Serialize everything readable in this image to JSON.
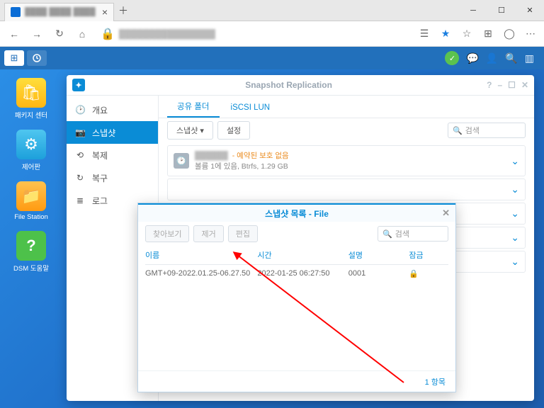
{
  "browser": {
    "tab_close": "×",
    "new_tab": "＋",
    "win_min": "─",
    "win_max": "☐",
    "win_close": "✕",
    "nav_back": "←",
    "nav_fwd": "→",
    "nav_reload": "↻",
    "nav_home": "⌂",
    "lock": "🔒",
    "reader": "☰",
    "star": "★",
    "fav": "☆",
    "ext": "⊞",
    "prof": "◯",
    "more": "⋯"
  },
  "dsm": {
    "launcher": "⊞",
    "chat": "💬",
    "user": "👤",
    "search": "🔍",
    "widget": "▥"
  },
  "desktop_icons": [
    {
      "label": "패키지 센터",
      "glyph": "🛍"
    },
    {
      "label": "제어판",
      "glyph": "⚙"
    },
    {
      "label": "File Station",
      "glyph": "📁"
    },
    {
      "label": "DSM 도움말",
      "glyph": "?"
    }
  ],
  "app": {
    "title": "Snapshot Replication",
    "win_help": "?",
    "win_min": "–",
    "win_max": "☐",
    "win_close": "✕",
    "sidebar": [
      {
        "icon": "🕑",
        "label": "개요"
      },
      {
        "icon": "📷",
        "label": "스냅샷"
      },
      {
        "icon": "⟲",
        "label": "복제"
      },
      {
        "icon": "↻",
        "label": "복구"
      },
      {
        "icon": "≣",
        "label": "로그"
      }
    ],
    "tabs": [
      {
        "label": "공유 폴더"
      },
      {
        "label": "iSCSI LUN"
      }
    ],
    "toolbar": {
      "snapshot": "스냅샷 ▾",
      "settings": "설정",
      "search_ph": "검색"
    },
    "folder": {
      "warn": "- 예약된 보호 없음",
      "sub": "볼륨 1에 있음, Btrfs, 1.29 GB",
      "time_glyph": "🕑"
    }
  },
  "dialog": {
    "title": "스냅샷 목록 - File",
    "btn_browse": "찾아보기",
    "btn_remove": "제거",
    "btn_edit": "편집",
    "search_ph": "검색",
    "search_icon": "🔍",
    "cols": {
      "name": "이름",
      "time": "시간",
      "desc": "설명",
      "lock": "잠금"
    },
    "row": {
      "name": "GMT+09-2022.01.25-06.27.50",
      "time": "2022-01-25 06:27:50",
      "desc": "0001",
      "lock": "🔒"
    },
    "footer": "1 항목"
  }
}
